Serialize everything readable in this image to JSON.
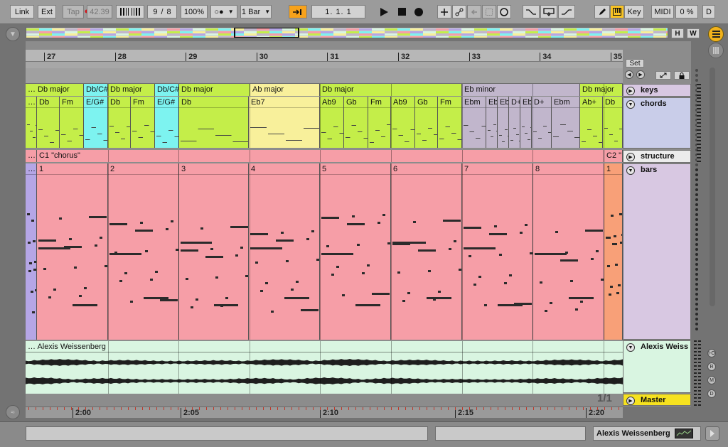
{
  "toolbar": {
    "link": "Link",
    "ext": "Ext",
    "tap": "Tap",
    "tempo": "42.39",
    "signature_num": "9",
    "signature_sep": "/",
    "signature_den": "8",
    "zoom": "100%",
    "metro_dots": "○●",
    "quantize": "1 Bar",
    "position": "1.  1.  1",
    "key_label": "Key",
    "midi_label": "MIDI",
    "cpu": "0 %",
    "d_label": "D"
  },
  "overview_buttons": {
    "h": "H",
    "w": "W"
  },
  "set_button": "Set",
  "bar_numbers": [
    "27",
    "28",
    "29",
    "30",
    "31",
    "32",
    "33",
    "34",
    "35"
  ],
  "tracks": {
    "keys": "keys",
    "chords": "chords",
    "structure": "structure",
    "bars": "bars",
    "audio": "Alexis Weiss",
    "master": "Master"
  },
  "keys_clips": [
    {
      "label": "… Db major",
      "color": "#c4ee49"
    },
    {
      "label": "Db/C#",
      "color": "#7df3f0"
    },
    {
      "label": "Db major",
      "color": "#c4ee49"
    },
    {
      "label": "Db/C#",
      "color": "#7df3f0"
    },
    {
      "label": "Db major",
      "color": "#c4ee49"
    },
    {
      "label": "Ab major",
      "color": "#f8f09b"
    },
    {
      "label": "Db major",
      "color": "#c4ee49"
    },
    {
      "label": "Eb minor",
      "color": "#c1b6cc"
    },
    {
      "label": "Db major",
      "color": "#c4ee49"
    }
  ],
  "chord_clips": [
    {
      "label": "…",
      "color": "#c4ee49"
    },
    {
      "label": "Db",
      "color": "#c4ee49"
    },
    {
      "label": "Fm",
      "color": "#c4ee49"
    },
    {
      "label": "E/G#",
      "color": "#7df3f0"
    },
    {
      "label": "Db",
      "color": "#c4ee49"
    },
    {
      "label": "Fm",
      "color": "#c4ee49"
    },
    {
      "label": "E/G#",
      "color": "#7df3f0"
    },
    {
      "label": "Db",
      "color": "#c4ee49"
    },
    {
      "label": "Eb7",
      "color": "#f8f09b"
    },
    {
      "label": "Ab9",
      "color": "#c4ee49"
    },
    {
      "label": "Gb",
      "color": "#c4ee49"
    },
    {
      "label": "Fm",
      "color": "#c4ee49"
    },
    {
      "label": "Ab9",
      "color": "#c4ee49"
    },
    {
      "label": "Gb",
      "color": "#c4ee49"
    },
    {
      "label": "Fm",
      "color": "#c4ee49"
    },
    {
      "label": "Ebm",
      "color": "#c1b6cc"
    },
    {
      "label": "Eb",
      "color": "#c1b6cc"
    },
    {
      "label": "Eb",
      "color": "#c1b6cc"
    },
    {
      "label": "D+",
      "color": "#c1b6cc"
    },
    {
      "label": "Eb",
      "color": "#c1b6cc"
    },
    {
      "label": "D+",
      "color": "#c1b6cc"
    },
    {
      "label": "Ebm",
      "color": "#c1b6cc"
    },
    {
      "label": "Ab+",
      "color": "#c4ee49"
    },
    {
      "label": "Db",
      "color": "#c4ee49"
    }
  ],
  "structure_clips": [
    {
      "label": "…",
      "color": "#f69ea7"
    },
    {
      "label": "C1 \"chorus\"",
      "color": "#f69ea7"
    },
    {
      "label": "C2 \"",
      "color": "#f69ea7"
    }
  ],
  "bars_clips": [
    {
      "label": "…",
      "color": "#b5a6e6"
    },
    {
      "label": "1",
      "color": "#f69ea7"
    },
    {
      "label": "2",
      "color": "#f69ea7"
    },
    {
      "label": "3",
      "color": "#f69ea7"
    },
    {
      "label": "4",
      "color": "#f69ea7"
    },
    {
      "label": "5",
      "color": "#f69ea7"
    },
    {
      "label": "6",
      "color": "#f69ea7"
    },
    {
      "label": "7",
      "color": "#f69ea7"
    },
    {
      "label": "8",
      "color": "#f69ea7"
    },
    {
      "label": "1",
      "color": "#f8a078"
    }
  ],
  "audio_clip": "… Alexis Weissenberg",
  "page_indicator": "1/1",
  "time_marks": [
    "2:00",
    "2:05",
    "2:10",
    "2:15",
    "2:20"
  ],
  "status_track_name": "Alexis Weissenberg",
  "side_buttons": [
    "I-O",
    "R",
    "M",
    "D"
  ]
}
